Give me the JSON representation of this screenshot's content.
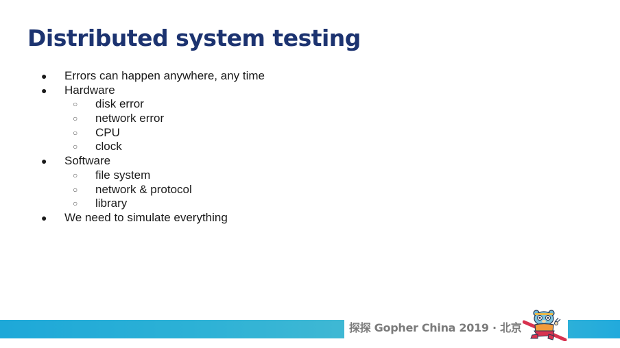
{
  "slide": {
    "title": "Distributed system testing",
    "bullets": [
      {
        "level": 1,
        "marker": "●",
        "text": "Errors can happen anywhere, any time"
      },
      {
        "level": 1,
        "marker": "●",
        "text": "Hardware"
      },
      {
        "level": 2,
        "marker": "○",
        "text": "disk error"
      },
      {
        "level": 2,
        "marker": "○",
        "text": "network error"
      },
      {
        "level": 2,
        "marker": "○",
        "text": "CPU"
      },
      {
        "level": 2,
        "marker": "○",
        "text": "clock"
      },
      {
        "level": 1,
        "marker": "●",
        "text": "Software"
      },
      {
        "level": 2,
        "marker": "○",
        "text": "file system"
      },
      {
        "level": 2,
        "marker": "○",
        "text": "network & protocol"
      },
      {
        "level": 2,
        "marker": "○",
        "text": "library"
      },
      {
        "level": 1,
        "marker": "●",
        "text": "We need to simulate everything"
      }
    ]
  },
  "footer": {
    "text": "探探 Gopher China 2019 · 北京",
    "mascot_icon": "gopher-mascot-icon",
    "colors": {
      "bar": "#22aadc",
      "text": "#7b7b7b",
      "title": "#1c3370"
    }
  }
}
